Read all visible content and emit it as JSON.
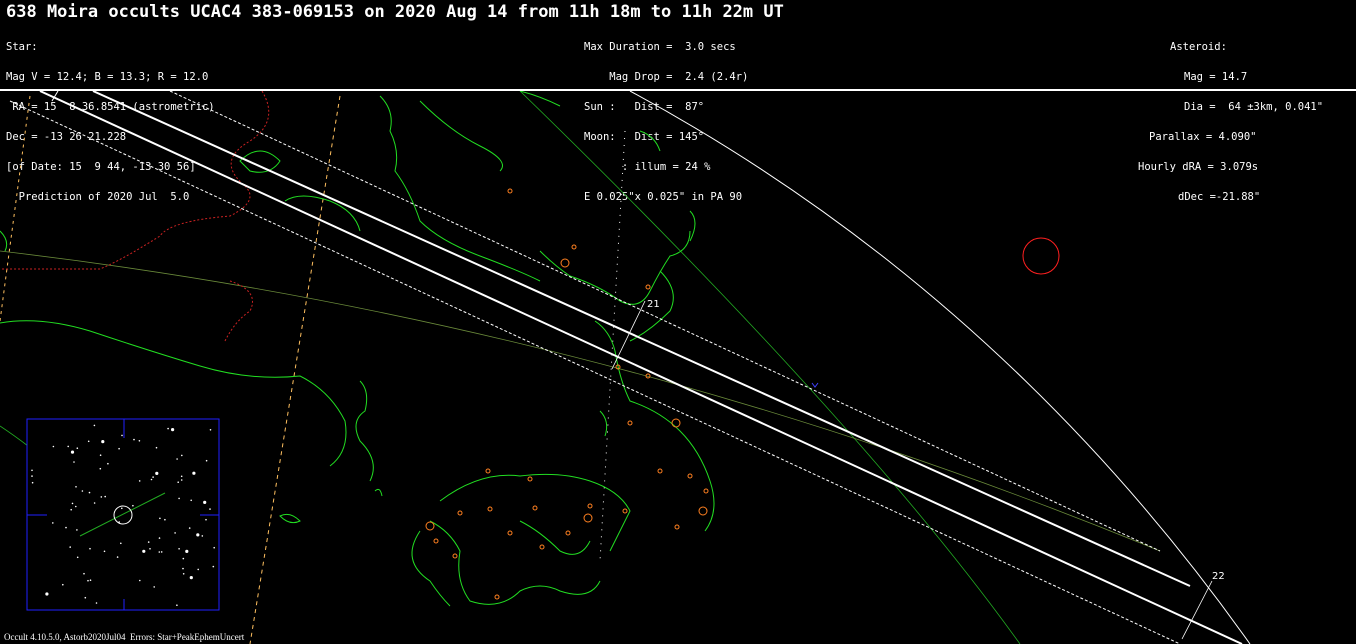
{
  "title": "638 Moira occults UCAC4 383-069153 on 2020 Aug 14 from 11h 18m to 11h 22m UT",
  "star_block": [
    "Star:",
    "Mag V = 12.4; B = 13.3; R = 12.0",
    " RA = 15  8 36.8541 (astrometric)",
    "Dec = -13 26 21.228",
    "[of Date: 15  9 44, -13 30 56]",
    "  Prediction of 2020 Jul  5.0"
  ],
  "event_block": [
    "Max Duration =  3.0 secs",
    "    Mag Drop =  2.4 (2.4r)",
    "Sun :   Dist =  87°",
    "Moon:   Dist = 145°",
    "      : illum = 24 %",
    "E 0.025\"x 0.025\" in PA 90"
  ],
  "asteroid_block": [
    "Asteroid:",
    "Mag = 14.7",
    "Dia =  64 ±3km, 0.041\"",
    "Parallax = 4.090\"",
    "Hourly dRA = 3.079s",
    "dDec =-21.88\""
  ],
  "time_labels": {
    "t21": "21",
    "t22": "22"
  },
  "footer": "Occult 4.10.5.0, Astorb2020Jul04  Errors: Star+PeakEphemUncert",
  "colors": {
    "background": "#000000",
    "coastline": "#22dd22",
    "border": "#cc2222",
    "path": "#ffffff",
    "sun_circle": "#ff2020",
    "finder_frame": "#2020ff",
    "town": "#ff8020"
  }
}
